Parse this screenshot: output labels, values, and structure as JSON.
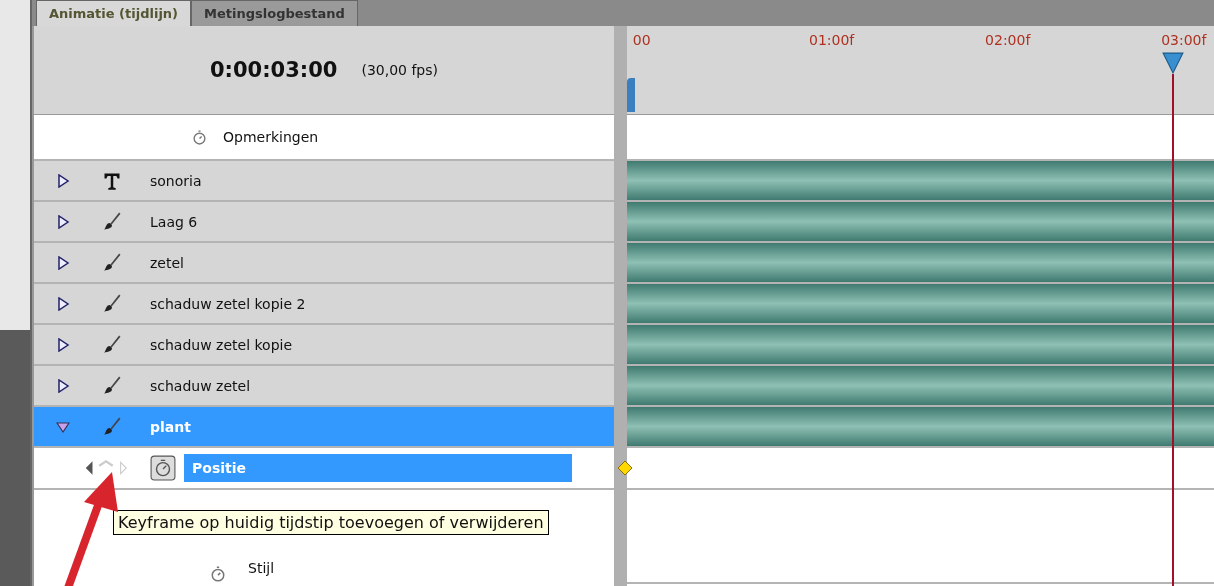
{
  "tabs": [
    {
      "label": "Animatie (tijdlijn)",
      "selected": true
    },
    {
      "label": "Metingslogbestand",
      "selected": false
    }
  ],
  "timecode": "0:00:03:00",
  "fps": "(30,00 fps)",
  "ruler": {
    "labels": [
      "00",
      "01:00f",
      "02:00f",
      "03:00f"
    ]
  },
  "comments": {
    "label": "Opmerkingen"
  },
  "layers": [
    {
      "name": "sonoria",
      "kind": "text",
      "expanded": false,
      "selected": false
    },
    {
      "name": "Laag 6",
      "kind": "paint",
      "expanded": false,
      "selected": false
    },
    {
      "name": "zetel",
      "kind": "paint",
      "expanded": false,
      "selected": false
    },
    {
      "name": "schaduw zetel kopie 2",
      "kind": "paint",
      "expanded": false,
      "selected": false
    },
    {
      "name": "schaduw zetel kopie",
      "kind": "paint",
      "expanded": false,
      "selected": false
    },
    {
      "name": "schaduw zetel",
      "kind": "paint",
      "expanded": false,
      "selected": false
    },
    {
      "name": "plant",
      "kind": "paint",
      "expanded": true,
      "selected": true
    }
  ],
  "properties": [
    {
      "name": "Positie",
      "selected": true,
      "keyframe": true
    },
    {
      "name": "Stijl",
      "selected": false,
      "keyframe": false
    }
  ],
  "tooltip": "Keyframe op huidig tijdstip toevoegen of verwijderen"
}
